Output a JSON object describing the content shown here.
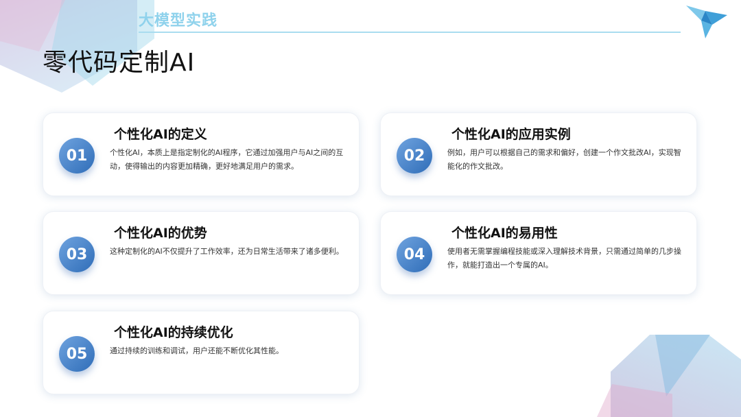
{
  "header": {
    "section_tag": "大模型实践",
    "title": "零代码定制AI"
  },
  "cards": [
    {
      "number": "01",
      "title": "个性化AI的定义",
      "description": "个性化AI，本质上是指定制化的AI程序，它通过加强用户与AI之间的互动，使得输出的内容更加精确，更好地满足用户的需求。"
    },
    {
      "number": "02",
      "title": "个性化AI的应用实例",
      "description": "例如，用户可以根据自己的需求和偏好，创建一个作文批改AI，实现智能化的作文批改。"
    },
    {
      "number": "03",
      "title": "个性化AI的优势",
      "description": "这种定制化的AI不仅提升了工作效率，还为日常生活带来了诸多便利。"
    },
    {
      "number": "04",
      "title": "个性化AI的易用性",
      "description": "使用者无需掌握编程技能或深入理解技术背景，只需通过简单的几步操作，就能打造出一个专属的AI。"
    },
    {
      "number": "05",
      "title": "个性化AI的持续优化",
      "description": "通过持续的训练和调试，用户还能不断优化其性能。"
    }
  ],
  "icons": {
    "logo": "origami-bird-icon"
  },
  "colors": {
    "accent": "#3a7cc8",
    "section_tag": "#8fd2ec",
    "header_line": "#a9dcef"
  }
}
